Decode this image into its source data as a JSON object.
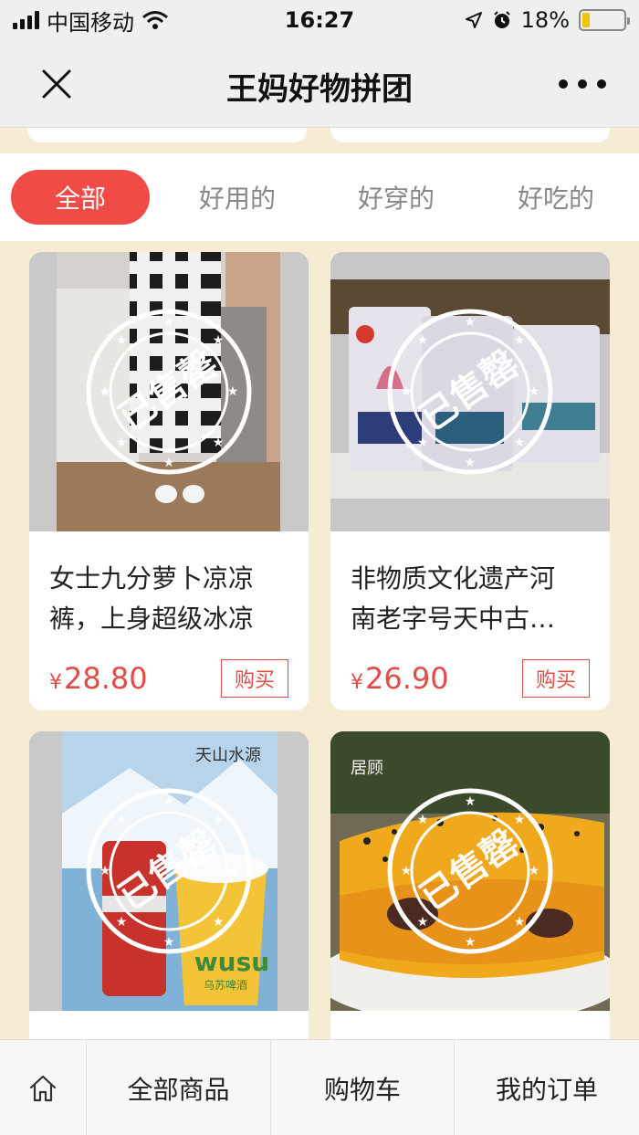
{
  "status_bar": {
    "carrier": "中国移动",
    "time": "16:27",
    "battery_percent": "18%",
    "battery_level": 0.18
  },
  "nav": {
    "title": "王妈好物拼团",
    "close_icon": "close-icon",
    "more_icon": "more-icon"
  },
  "tabs": [
    {
      "label": "全部",
      "active": true
    },
    {
      "label": "好用的",
      "active": false
    },
    {
      "label": "好穿的",
      "active": false
    },
    {
      "label": "好吃的",
      "active": false
    }
  ],
  "sold_out_stamp": "已售罄",
  "products": [
    {
      "name_line1": "女士九分萝卜凉凉",
      "name_line2": "裤，上身超级冰凉",
      "currency": "¥",
      "price": "28.80",
      "buy_label": "购买"
    },
    {
      "name_line1": "非物质文化遗产河",
      "name_line2": "南老字号天中古…",
      "currency": "¥",
      "price": "26.90",
      "buy_label": "购买"
    },
    {
      "image_text_1": "天山水源",
      "image_text_2": "wusu",
      "image_text_3": "乌苏啤酒"
    },
    {
      "image_text_1": "居顾"
    }
  ],
  "bottom_bar": {
    "home_icon": "home-icon",
    "all_products": "全部商品",
    "cart": "购物车",
    "orders": "我的订单"
  },
  "colors": {
    "accent": "#f04b47",
    "price": "#e14c47",
    "page_bg": "#f6ecd3"
  }
}
